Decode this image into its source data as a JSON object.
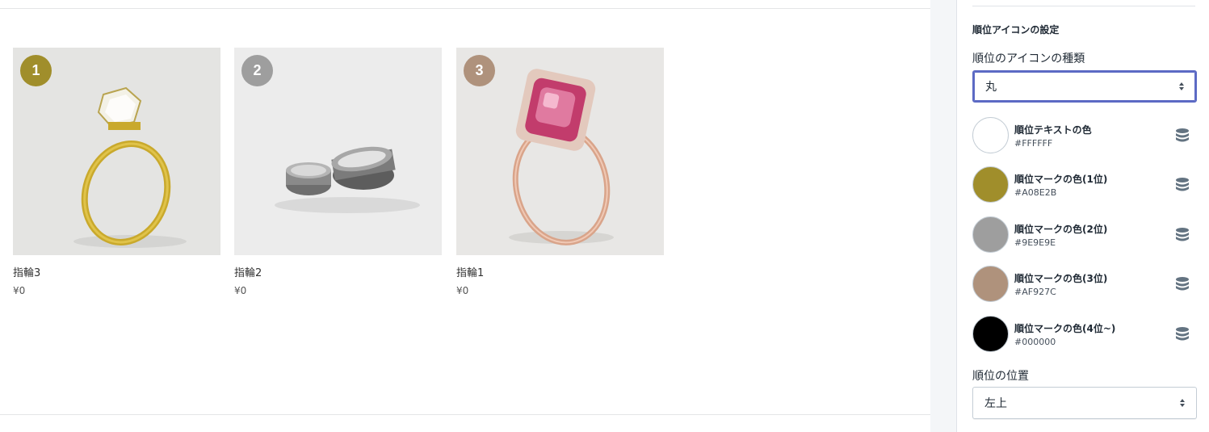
{
  "products": [
    {
      "rank": "1",
      "name": "指輪3",
      "price": "¥0",
      "badge_color": "#A08E2B",
      "image": "gold-ring-image"
    },
    {
      "rank": "2",
      "name": "指輪2",
      "price": "¥0",
      "badge_color": "#9E9E9E",
      "image": "silver-bands-image"
    },
    {
      "rank": "3",
      "name": "指輪1",
      "price": "¥0",
      "badge_color": "#AF927C",
      "image": "pink-ring-image"
    }
  ],
  "settings": {
    "section_title": "順位アイコンの設定",
    "icon_type": {
      "label": "順位のアイコンの種類",
      "value": "丸"
    },
    "colors": [
      {
        "name": "順位テキストの色",
        "hex": "#FFFFFF",
        "swatch": "#FFFFFF"
      },
      {
        "name": "順位マークの色(1位)",
        "hex": "#A08E2B",
        "swatch": "#A08E2B"
      },
      {
        "name": "順位マークの色(2位)",
        "hex": "#9E9E9E",
        "swatch": "#9E9E9E"
      },
      {
        "name": "順位マークの色(3位)",
        "hex": "#AF927C",
        "swatch": "#AF927C"
      },
      {
        "name": "順位マークの色(4位~)",
        "hex": "#000000",
        "swatch": "#000000"
      }
    ],
    "position": {
      "label": "順位の位置",
      "value": "左上"
    }
  }
}
